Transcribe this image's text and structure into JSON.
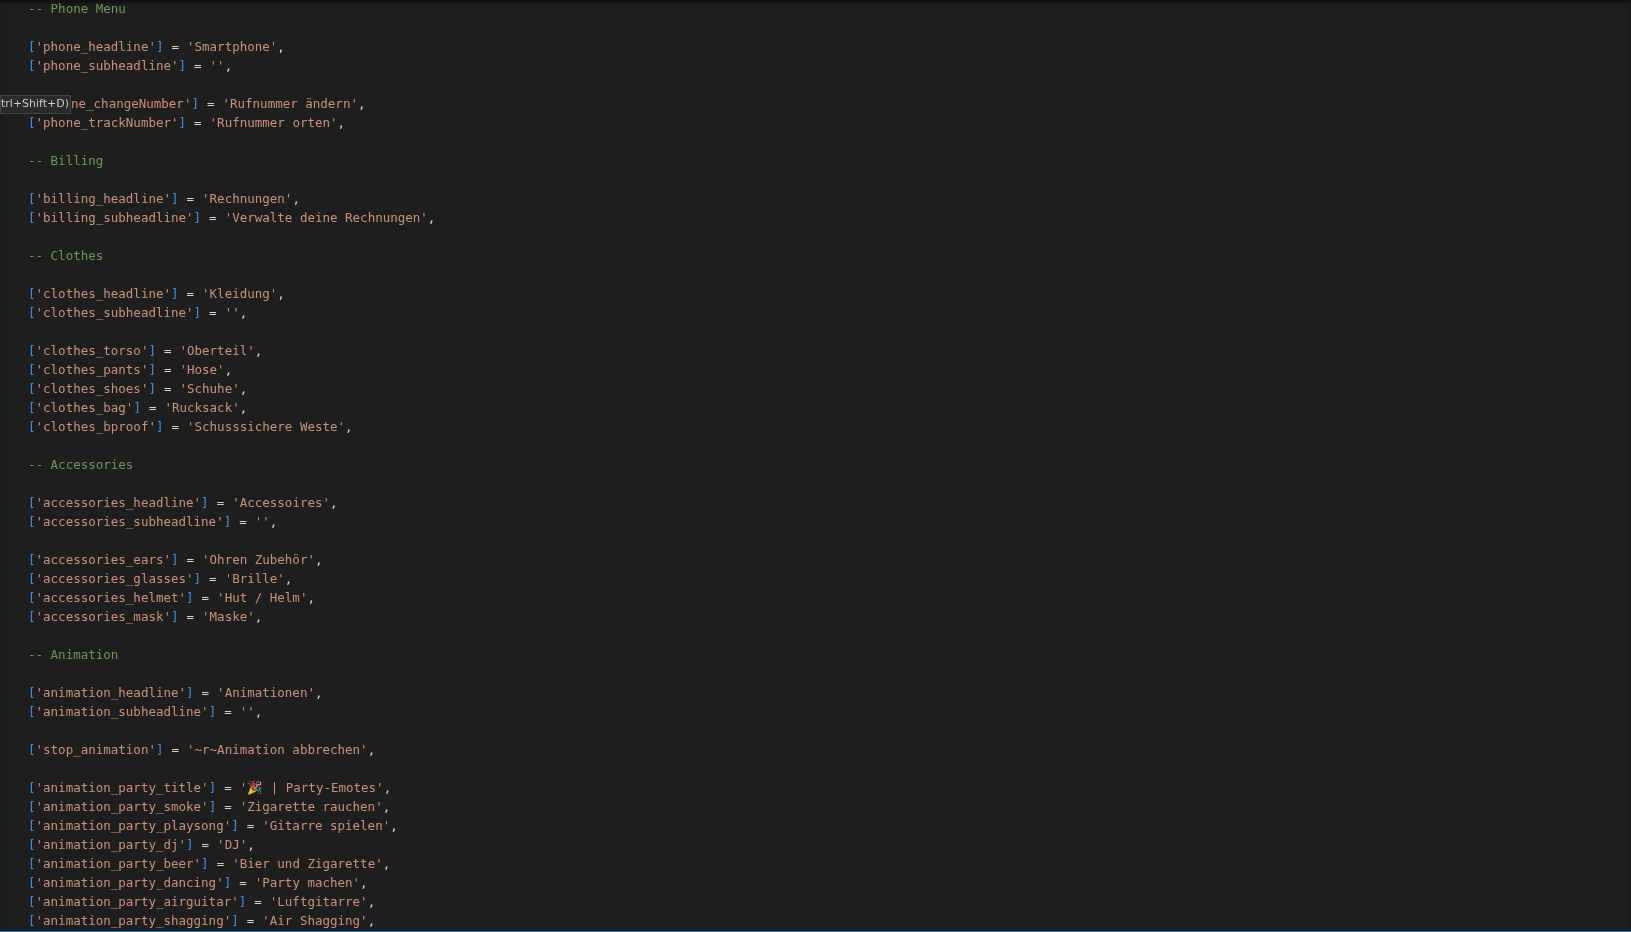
{
  "tooltip": "trl+Shift+D)",
  "lines": [
    {
      "kind": "comment",
      "text": "-- Phone Menu"
    },
    {
      "kind": "blank"
    },
    {
      "kind": "entry",
      "parts": [
        "[",
        "'phone_headline'",
        "]",
        "=",
        "'Smartphone'",
        ","
      ]
    },
    {
      "kind": "entry",
      "parts": [
        "[",
        "'phone_subheadline'",
        "]",
        "=",
        "''",
        ","
      ]
    },
    {
      "kind": "blank"
    },
    {
      "kind": "covered",
      "parts": [
        "ne_changeNumber'",
        "]",
        "=",
        "'Rufnummer ändern'",
        ","
      ]
    },
    {
      "kind": "entry",
      "parts": [
        "[",
        "'phone_trackNumber'",
        "]",
        "=",
        "'Rufnummer orten'",
        ","
      ]
    },
    {
      "kind": "blank"
    },
    {
      "kind": "comment",
      "text": "-- Billing"
    },
    {
      "kind": "blank"
    },
    {
      "kind": "entry",
      "parts": [
        "[",
        "'billing_headline'",
        "]",
        "=",
        "'Rechnungen'",
        ","
      ]
    },
    {
      "kind": "entry",
      "parts": [
        "[",
        "'billing_subheadline'",
        "]",
        "=",
        "'Verwalte deine Rechnungen'",
        ","
      ]
    },
    {
      "kind": "blank"
    },
    {
      "kind": "comment",
      "text": "-- Clothes"
    },
    {
      "kind": "blank"
    },
    {
      "kind": "entry",
      "parts": [
        "[",
        "'clothes_headline'",
        "]",
        "=",
        "'Kleidung'",
        ","
      ]
    },
    {
      "kind": "entry",
      "parts": [
        "[",
        "'clothes_subheadline'",
        "]",
        "=",
        "''",
        ","
      ]
    },
    {
      "kind": "blank"
    },
    {
      "kind": "entry",
      "parts": [
        "[",
        "'clothes_torso'",
        "]",
        "=",
        "'Oberteil'",
        ","
      ]
    },
    {
      "kind": "entry",
      "parts": [
        "[",
        "'clothes_pants'",
        "]",
        "=",
        "'Hose'",
        ","
      ]
    },
    {
      "kind": "entry",
      "parts": [
        "[",
        "'clothes_shoes'",
        "]",
        "=",
        "'Schuhe'",
        ","
      ]
    },
    {
      "kind": "entry",
      "parts": [
        "[",
        "'clothes_bag'",
        "]",
        "=",
        "'Rucksack'",
        ","
      ]
    },
    {
      "kind": "entry",
      "parts": [
        "[",
        "'clothes_bproof'",
        "]",
        "=",
        "'Schusssichere Weste'",
        ","
      ]
    },
    {
      "kind": "blank"
    },
    {
      "kind": "comment",
      "text": "-- Accessories"
    },
    {
      "kind": "blank"
    },
    {
      "kind": "entry",
      "parts": [
        "[",
        "'accessories_headline'",
        "]",
        "=",
        "'Accessoires'",
        ","
      ]
    },
    {
      "kind": "entry",
      "parts": [
        "[",
        "'accessories_subheadline'",
        "]",
        "=",
        "''",
        ","
      ]
    },
    {
      "kind": "blank"
    },
    {
      "kind": "entry",
      "parts": [
        "[",
        "'accessories_ears'",
        "]",
        "=",
        "'Ohren Zubehör'",
        ","
      ]
    },
    {
      "kind": "entry",
      "parts": [
        "[",
        "'accessories_glasses'",
        "]",
        "=",
        "'Brille'",
        ","
      ]
    },
    {
      "kind": "entry",
      "parts": [
        "[",
        "'accessories_helmet'",
        "]",
        "=",
        "'Hut / Helm'",
        ","
      ]
    },
    {
      "kind": "entry",
      "parts": [
        "[",
        "'accessories_mask'",
        "]",
        "=",
        "'Maske'",
        ","
      ]
    },
    {
      "kind": "blank"
    },
    {
      "kind": "comment",
      "text": "-- Animation"
    },
    {
      "kind": "blank"
    },
    {
      "kind": "entry",
      "parts": [
        "[",
        "'animation_headline'",
        "]",
        "=",
        "'Animationen'",
        ","
      ]
    },
    {
      "kind": "entry",
      "parts": [
        "[",
        "'animation_subheadline'",
        "]",
        "=",
        "''",
        ","
      ]
    },
    {
      "kind": "blank"
    },
    {
      "kind": "entry",
      "parts": [
        "[",
        "'stop_animation'",
        "]",
        "=",
        "'~r~Animation abbrechen'",
        ","
      ]
    },
    {
      "kind": "blank"
    },
    {
      "kind": "entry",
      "parts": [
        "[",
        "'animation_party_title'",
        "]",
        "=",
        "'🎉 | Party-Emotes'",
        ","
      ]
    },
    {
      "kind": "entry",
      "parts": [
        "[",
        "'animation_party_smoke'",
        "]",
        "=",
        "'Zigarette rauchen'",
        ","
      ]
    },
    {
      "kind": "entry",
      "parts": [
        "[",
        "'animation_party_playsong'",
        "]",
        "=",
        "'Gitarre spielen'",
        ","
      ]
    },
    {
      "kind": "entry",
      "parts": [
        "[",
        "'animation_party_dj'",
        "]",
        "=",
        "'DJ'",
        ","
      ]
    },
    {
      "kind": "entry",
      "parts": [
        "[",
        "'animation_party_beer'",
        "]",
        "=",
        "'Bier und Zigarette'",
        ","
      ]
    },
    {
      "kind": "entry",
      "parts": [
        "[",
        "'animation_party_dancing'",
        "]",
        "=",
        "'Party machen'",
        ","
      ]
    },
    {
      "kind": "entry",
      "parts": [
        "[",
        "'animation_party_airguitar'",
        "]",
        "=",
        "'Luftgitarre'",
        ","
      ]
    },
    {
      "kind": "entry",
      "parts": [
        "[",
        "'animation_party_shagging'",
        "]",
        "=",
        "'Air Shagging'",
        ","
      ]
    }
  ]
}
